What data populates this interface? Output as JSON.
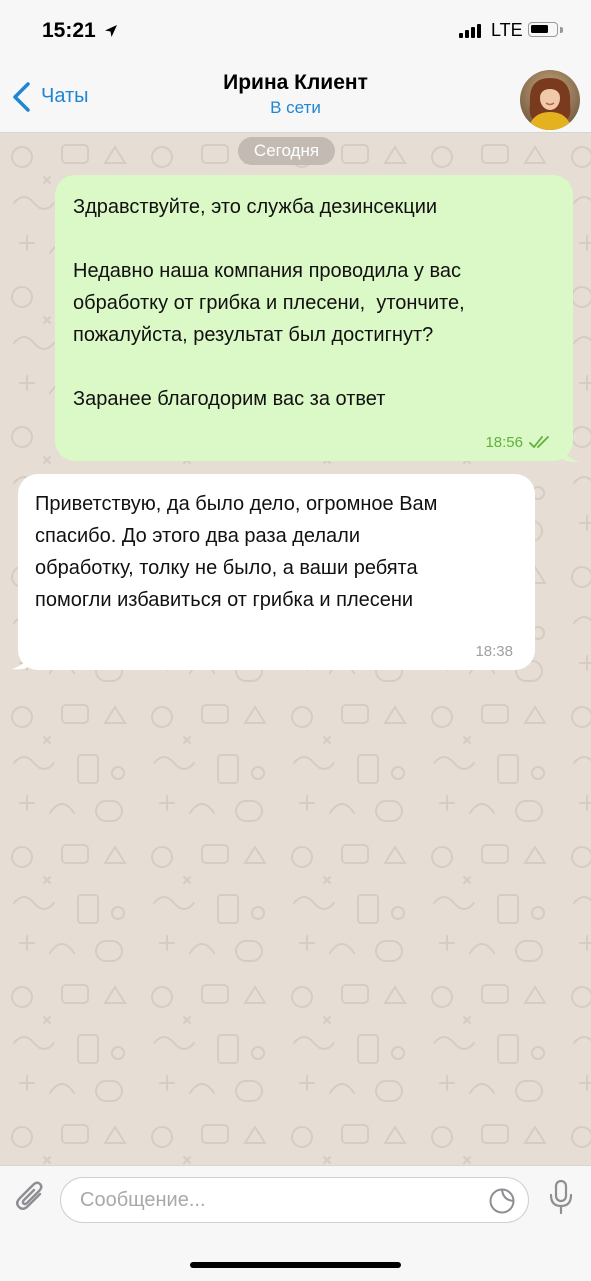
{
  "status_bar": {
    "time": "15:21",
    "network": "LTE",
    "icons": [
      "location-arrow-icon",
      "signal-icon",
      "battery-icon"
    ]
  },
  "header": {
    "back_label": "Чаты",
    "contact_name": "Ирина Клиент",
    "contact_status": "В сети",
    "accent_color": "#1f86d4"
  },
  "chat": {
    "date_label": "Сегодня",
    "messages": [
      {
        "direction": "outgoing",
        "lines": [
          "Здравствуйте, это служба дезинсекции",
          "",
          "Недавно наша компания проводила у вас",
          "обработку от грибка и плесени,  утончите,",
          "пожалуйста, результат был достигнут?",
          "",
          "Заранее благодорим вас за ответ"
        ],
        "time": "18:56",
        "read": true,
        "bubble_color": "#dbf8c7"
      },
      {
        "direction": "incoming",
        "lines": [
          "Приветствую, да было дело, огромное Вам",
          "спасибо. До этого два раза делали",
          "обработку, толку не было, а ваши ребята",
          "помогли избавиться от грибка и плесени"
        ],
        "time": "18:38",
        "bubble_color": "#ffffff"
      }
    ]
  },
  "composer": {
    "placeholder": "Сообщение..."
  }
}
